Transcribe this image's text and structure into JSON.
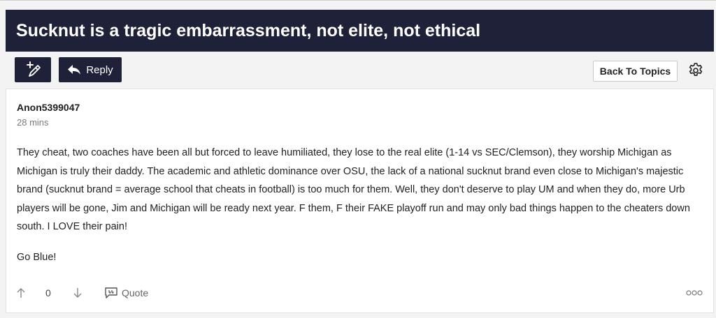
{
  "topic": {
    "title": "Sucknut is a tragic embarrassment, not elite, not ethical"
  },
  "toolbar": {
    "reply_label": "Reply",
    "back_label": "Back To Topics"
  },
  "post": {
    "author": "Anon5399047",
    "time": "28 mins",
    "body": "They cheat, two coaches have been all but forced to leave humiliated, they lose to the real elite (1-14 vs SEC/Clemson), they worship Michigan as Michigan is truly their daddy. The academic and athletic dominance over OSU, the lack of a national sucknut brand even close to Michigan's majestic brand (sucknut brand = average school that cheats in football) is too much for them. Well, they don't deserve to play UM and when they do, more Urb players will be gone, Jim and Michigan will be ready next year. F them, F their FAKE playoff run and may only bad things happen to the cheaters down south. I LOVE their pain!",
    "signoff": "Go Blue!",
    "vote_count": "0",
    "quote_label": "Quote"
  },
  "icons": {
    "new": "new-post-pencil-icon",
    "reply": "reply-arrow-icon",
    "settings": "gear-icon",
    "upvote": "arrow-up-icon",
    "downvote": "arrow-down-icon",
    "quote": "quote-bubble-icon",
    "more": "more-dots-icon"
  },
  "colors": {
    "header_bg": "#1f2138",
    "page_bg": "#f3f3f3"
  }
}
